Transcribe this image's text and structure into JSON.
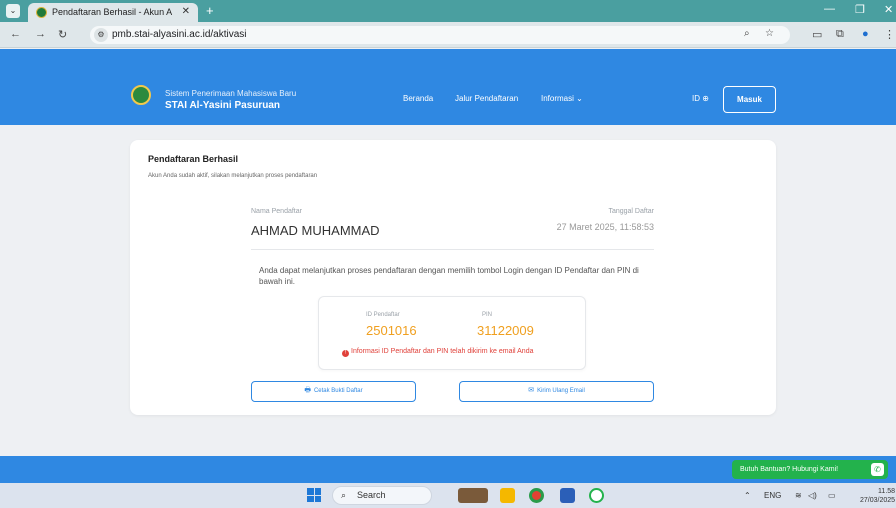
{
  "browser": {
    "tab_title": "Pendaftaran Berhasil - Akun An",
    "tab_close": "✕",
    "new_tab": "+",
    "url": "pmb.stai-alyasini.ac.id/aktivasi"
  },
  "header": {
    "subtitle": "Sistem Penerimaan Mahasiswa Baru",
    "title": "STAI Al-Yasini Pasuruan",
    "nav": [
      "Beranda",
      "Jalur Pendaftaran",
      "Informasi ⌄"
    ],
    "lang": "ID",
    "login_label": "Masuk"
  },
  "card": {
    "title": "Pendaftaran Berhasil",
    "subtitle": "Akun Anda sudah aktif, silakan melanjutkan proses pendaftaran",
    "name_label": "Nama Pendaftar",
    "name": "AHMAD MUHAMMAD",
    "date_label": "Tanggal Daftar",
    "date": "27 Maret 2025, 11:58:53",
    "info": "Anda dapat melanjutkan proses pendaftaran dengan memilih tombol Login dengan ID Pendaftar dan PIN di bawah ini.",
    "id_label": "ID Pendaftar",
    "id_value": "2501016",
    "pin_label": "PIN",
    "pin_value": "31122009",
    "alert": "Informasi ID Pendaftar dan PIN telah dikirim ke email Anda",
    "print_label": "Cetak Bukti Daftar",
    "email_label": "Kirim Ulang Email"
  },
  "footer": {
    "help_label": "Butuh Bantuan? Hubungi Kami!"
  },
  "taskbar": {
    "search_label": "Search",
    "lang": "ENG",
    "time": "11.58",
    "date": "27/03/2025"
  },
  "colors": {
    "primary": "#2f88e2",
    "accent": "#f0a020",
    "alert": "#e0413a",
    "whatsapp": "#23b24c"
  }
}
